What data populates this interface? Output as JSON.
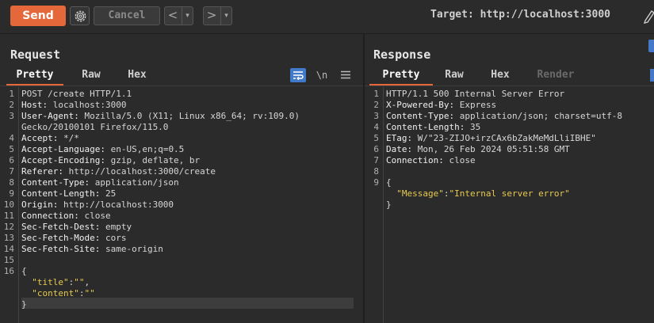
{
  "toolbar": {
    "send_label": "Send",
    "cancel_label": "Cancel",
    "back_label": "<",
    "forward_label": ">",
    "dropdown_glyph": "▾",
    "target_text": "Target: http://localhost:3000",
    "accent_color": "#e5683b"
  },
  "request": {
    "title": "Request",
    "tabs": [
      {
        "label": "Pretty",
        "active": true
      },
      {
        "label": "Raw",
        "active": false
      },
      {
        "label": "Hex",
        "active": false
      }
    ],
    "tools": {
      "wrap_icon": "wrap-icon",
      "newline_label": "\\n",
      "menu_icon": "hamburger-menu-icon"
    },
    "lines": [
      {
        "n": "1",
        "text": "POST /create HTTP/1.1"
      },
      {
        "n": "2",
        "key": "Host:",
        "val": " localhost:3000"
      },
      {
        "n": "3",
        "key": "User-Agent:",
        "val": " Mozilla/5.0 (X11; Linux x86_64; rv:109.0)"
      },
      {
        "n": "",
        "text": "Gecko/20100101 Firefox/115.0"
      },
      {
        "n": "4",
        "key": "Accept:",
        "val": " */*"
      },
      {
        "n": "5",
        "key": "Accept-Language:",
        "val": " en-US,en;q=0.5"
      },
      {
        "n": "6",
        "key": "Accept-Encoding:",
        "val": " gzip, deflate, br"
      },
      {
        "n": "7",
        "key": "Referer:",
        "val": " http://localhost:3000/create"
      },
      {
        "n": "8",
        "key": "Content-Type:",
        "val": " application/json"
      },
      {
        "n": "9",
        "key": "Content-Length:",
        "val": " 25"
      },
      {
        "n": "10",
        "key": "Origin:",
        "val": " http://localhost:3000"
      },
      {
        "n": "11",
        "key": "Connection:",
        "val": " close"
      },
      {
        "n": "12",
        "key": "Sec-Fetch-Dest:",
        "val": " empty"
      },
      {
        "n": "13",
        "key": "Sec-Fetch-Mode:",
        "val": " cors"
      },
      {
        "n": "14",
        "key": "Sec-Fetch-Site:",
        "val": " same-origin"
      },
      {
        "n": "15",
        "text": ""
      },
      {
        "n": "16",
        "text": "{"
      },
      {
        "n": "",
        "jkey": "  \"title\"",
        "sep": ":",
        "jval": "\"\"",
        "tail": ","
      },
      {
        "n": "",
        "jkey": "  \"content\"",
        "sep": ":",
        "jval": "\"\"",
        "tail": ""
      },
      {
        "n": "",
        "text": "}"
      }
    ]
  },
  "response": {
    "title": "Response",
    "tabs": [
      {
        "label": "Pretty",
        "active": true
      },
      {
        "label": "Raw",
        "active": false
      },
      {
        "label": "Hex",
        "active": false
      },
      {
        "label": "Render",
        "active": false,
        "disabled": true
      }
    ],
    "lines": [
      {
        "n": "1",
        "text": "HTTP/1.1 500 Internal Server Error"
      },
      {
        "n": "2",
        "key": "X-Powered-By:",
        "val": " Express"
      },
      {
        "n": "3",
        "key": "Content-Type:",
        "val": " application/json; charset=utf-8"
      },
      {
        "n": "4",
        "key": "Content-Length:",
        "val": " 35"
      },
      {
        "n": "5",
        "key": "ETag:",
        "val": " W/\"23-ZIJO+irzCAx6bZakMeMdLliIBHE\""
      },
      {
        "n": "6",
        "key": "Date:",
        "val": " Mon, 26 Feb 2024 05:51:58 GMT"
      },
      {
        "n": "7",
        "key": "Connection:",
        "val": " close"
      },
      {
        "n": "8",
        "text": ""
      },
      {
        "n": "9",
        "text": "{"
      },
      {
        "n": "",
        "jkey": "  \"Message\"",
        "sep": ":",
        "jval": "\"Internal server error\"",
        "tail": ""
      },
      {
        "n": "",
        "text": "}"
      }
    ]
  }
}
